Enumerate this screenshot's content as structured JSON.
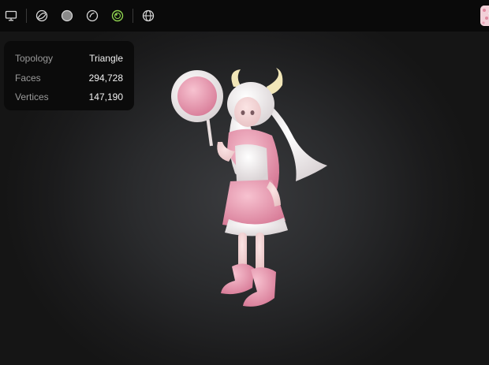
{
  "toolbar": {
    "icons": [
      "monitor-icon",
      "wireframe-sphere-icon",
      "solid-sphere-icon",
      "outline-sphere-icon",
      "textured-sphere-icon",
      "globe-icon"
    ],
    "active_color": "#8fd14f"
  },
  "stats": {
    "rows": [
      {
        "label": "Topology",
        "value": "Triangle"
      },
      {
        "label": "Faces",
        "value": "294,728"
      },
      {
        "label": "Vertices",
        "value": "147,190"
      }
    ]
  },
  "colors": {
    "background": "#2a2b2d",
    "toolbar": "#0a0a0a",
    "panel": "#0b0b0b",
    "model_pink": "#e89ab0",
    "model_white": "#f2eeee"
  }
}
